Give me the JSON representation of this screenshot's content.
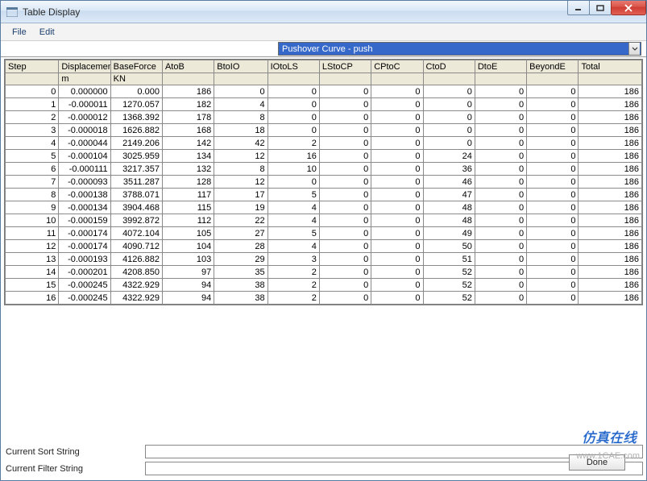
{
  "window": {
    "title": "Table Display"
  },
  "menu": {
    "file": "File",
    "edit": "Edit"
  },
  "dropdown": {
    "selected": "Pushover Curve - push"
  },
  "columns": [
    "Step",
    "Displacement",
    "BaseForce",
    "AtoB",
    "BtoIO",
    "IOtoLS",
    "LStoCP",
    "CPtoC",
    "CtoD",
    "DtoE",
    "BeyondE",
    "Total"
  ],
  "units": [
    "",
    "m",
    "KN",
    "",
    "",
    "",
    "",
    "",
    "",
    "",
    "",
    ""
  ],
  "rows": [
    [
      "0",
      "0.000000",
      "0.000",
      "186",
      "0",
      "0",
      "0",
      "0",
      "0",
      "0",
      "0",
      "186"
    ],
    [
      "1",
      "-0.000011",
      "1270.057",
      "182",
      "4",
      "0",
      "0",
      "0",
      "0",
      "0",
      "0",
      "186"
    ],
    [
      "2",
      "-0.000012",
      "1368.392",
      "178",
      "8",
      "0",
      "0",
      "0",
      "0",
      "0",
      "0",
      "186"
    ],
    [
      "3",
      "-0.000018",
      "1626.882",
      "168",
      "18",
      "0",
      "0",
      "0",
      "0",
      "0",
      "0",
      "186"
    ],
    [
      "4",
      "-0.000044",
      "2149.206",
      "142",
      "42",
      "2",
      "0",
      "0",
      "0",
      "0",
      "0",
      "186"
    ],
    [
      "5",
      "-0.000104",
      "3025.959",
      "134",
      "12",
      "16",
      "0",
      "0",
      "24",
      "0",
      "0",
      "186"
    ],
    [
      "6",
      "-0.000111",
      "3217.357",
      "132",
      "8",
      "10",
      "0",
      "0",
      "36",
      "0",
      "0",
      "186"
    ],
    [
      "7",
      "-0.000093",
      "3511.287",
      "128",
      "12",
      "0",
      "0",
      "0",
      "46",
      "0",
      "0",
      "186"
    ],
    [
      "8",
      "-0.000138",
      "3788.071",
      "117",
      "17",
      "5",
      "0",
      "0",
      "47",
      "0",
      "0",
      "186"
    ],
    [
      "9",
      "-0.000134",
      "3904.468",
      "115",
      "19",
      "4",
      "0",
      "0",
      "48",
      "0",
      "0",
      "186"
    ],
    [
      "10",
      "-0.000159",
      "3992.872",
      "112",
      "22",
      "4",
      "0",
      "0",
      "48",
      "0",
      "0",
      "186"
    ],
    [
      "11",
      "-0.000174",
      "4072.104",
      "105",
      "27",
      "5",
      "0",
      "0",
      "49",
      "0",
      "0",
      "186"
    ],
    [
      "12",
      "-0.000174",
      "4090.712",
      "104",
      "28",
      "4",
      "0",
      "0",
      "50",
      "0",
      "0",
      "186"
    ],
    [
      "13",
      "-0.000193",
      "4126.882",
      "103",
      "29",
      "3",
      "0",
      "0",
      "51",
      "0",
      "0",
      "186"
    ],
    [
      "14",
      "-0.000201",
      "4208.850",
      "97",
      "35",
      "2",
      "0",
      "0",
      "52",
      "0",
      "0",
      "186"
    ],
    [
      "15",
      "-0.000245",
      "4322.929",
      "94",
      "38",
      "2",
      "0",
      "0",
      "52",
      "0",
      "0",
      "186"
    ],
    [
      "16",
      "-0.000245",
      "4322.929",
      "94",
      "38",
      "2",
      "0",
      "0",
      "52",
      "0",
      "0",
      "186"
    ]
  ],
  "bottom": {
    "sort_label": "Current Sort String",
    "filter_label": "Current Filter String",
    "sort_value": "",
    "filter_value": ""
  },
  "buttons": {
    "done": "Done"
  },
  "watermark": {
    "url": "www.1CAE.com",
    "cn": "仿真在线"
  }
}
